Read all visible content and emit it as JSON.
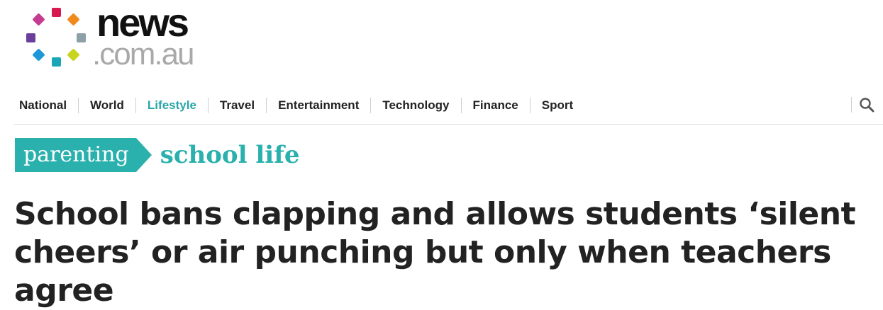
{
  "logo": {
    "wordmark": "news",
    "domain": ".com.au",
    "dot_colors": [
      "#d6194f",
      "#f08a1d",
      "#8da0a8",
      "#c9d41e",
      "#1aa6b4",
      "#1c97d8",
      "#6a3f9b",
      "#c43b8f"
    ]
  },
  "nav": {
    "items": [
      {
        "label": "National"
      },
      {
        "label": "World"
      },
      {
        "label": "Lifestyle",
        "active": true
      },
      {
        "label": "Travel"
      },
      {
        "label": "Entertainment"
      },
      {
        "label": "Technology"
      },
      {
        "label": "Finance"
      },
      {
        "label": "Sport"
      }
    ],
    "search_icon": "search-icon"
  },
  "section": {
    "primary": "parenting",
    "secondary": "school life",
    "accent_color": "#2ab0ad"
  },
  "article": {
    "headline": "School bans clapping and allows students ‘silent cheers’ or air punching but only when teachers agree"
  }
}
